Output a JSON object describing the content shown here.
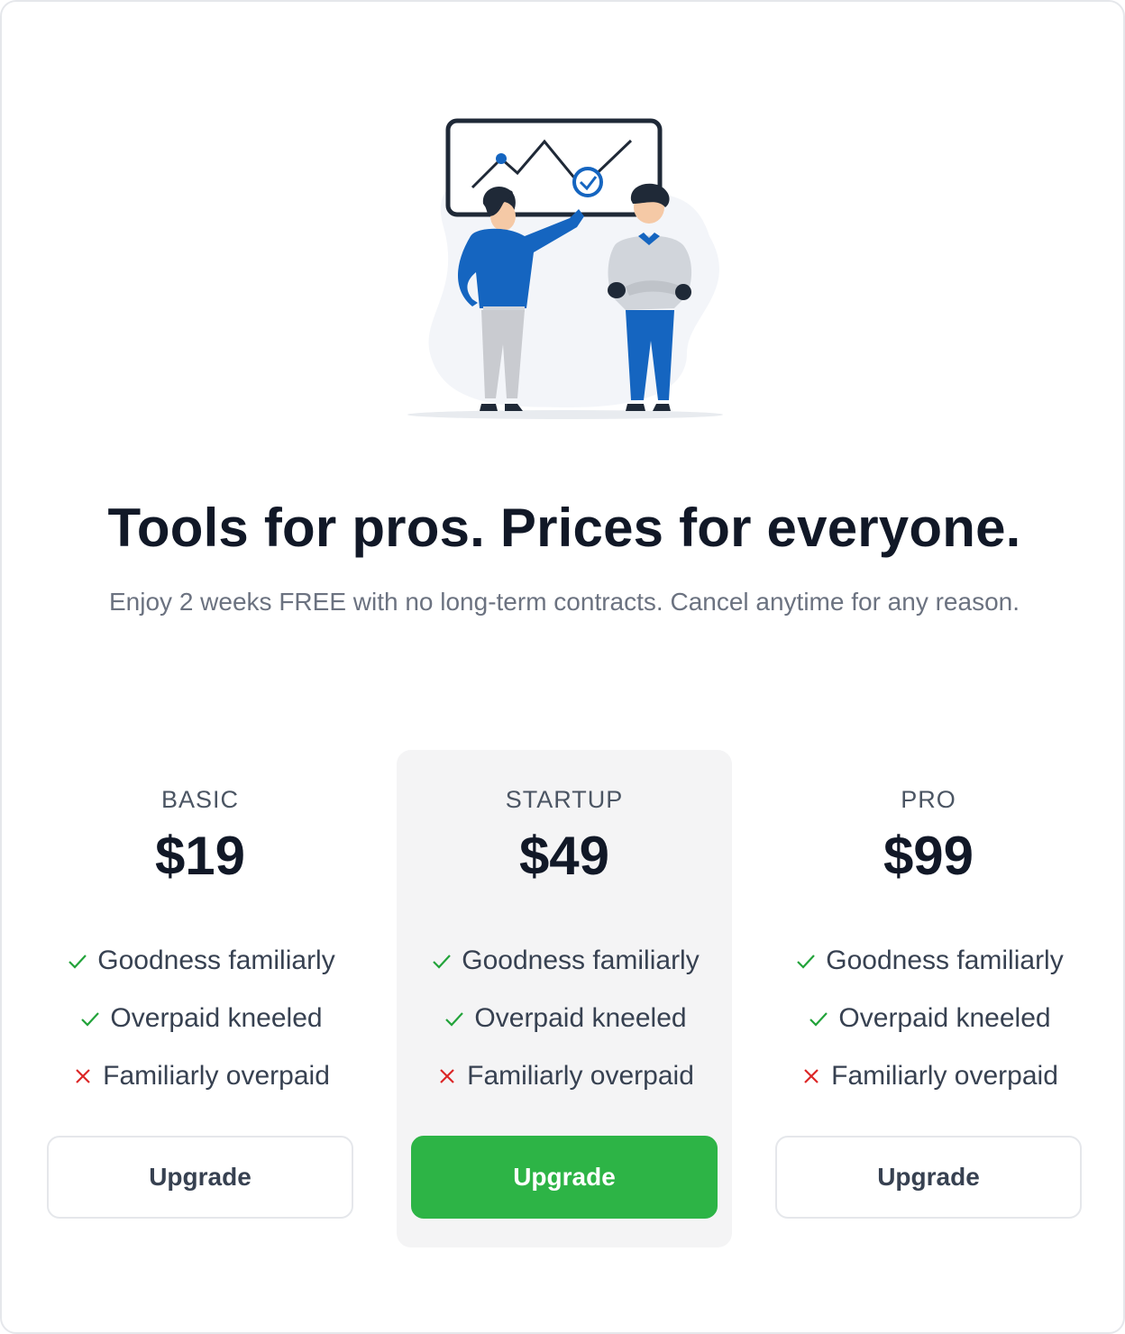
{
  "hero": {
    "illustration_icon": "team-presentation-illustration",
    "headline": "Tools for pros. Prices for everyone.",
    "subtitle": "Enjoy 2 weeks FREE with no long-term contracts. Cancel anytime for any reason."
  },
  "colors": {
    "accent": "#2db446",
    "figure_blue": "#1565c0",
    "check_green": "#22a33a",
    "cross_red": "#dc2626"
  },
  "plans": [
    {
      "name": "BASIC",
      "price": "$19",
      "featured": false,
      "features": [
        {
          "label": "Goodness familiarly",
          "included": true
        },
        {
          "label": "Overpaid kneeled",
          "included": true
        },
        {
          "label": "Familiarly overpaid",
          "included": false
        }
      ],
      "button_label": "Upgrade"
    },
    {
      "name": "STARTUP",
      "price": "$49",
      "featured": true,
      "features": [
        {
          "label": "Goodness familiarly",
          "included": true
        },
        {
          "label": "Overpaid kneeled",
          "included": true
        },
        {
          "label": "Familiarly overpaid",
          "included": false
        }
      ],
      "button_label": "Upgrade"
    },
    {
      "name": "PRO",
      "price": "$99",
      "featured": false,
      "features": [
        {
          "label": "Goodness familiarly",
          "included": true
        },
        {
          "label": "Overpaid kneeled",
          "included": true
        },
        {
          "label": "Familiarly overpaid",
          "included": false
        }
      ],
      "button_label": "Upgrade"
    }
  ]
}
